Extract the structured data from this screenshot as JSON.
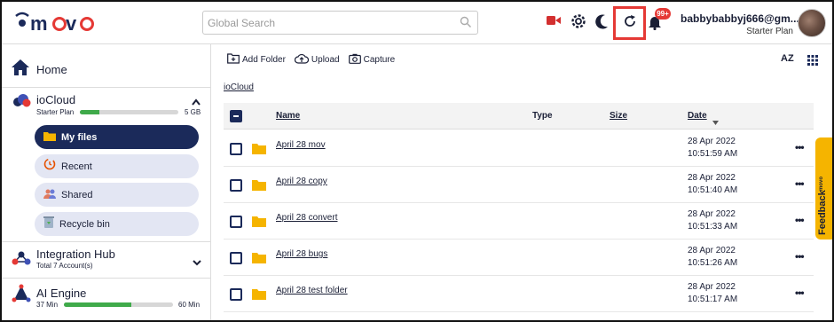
{
  "header": {
    "logo_text": "movo",
    "search_placeholder": "Global Search",
    "notification_count": "99+",
    "user_email": "babbybabbyj666@gm...",
    "user_plan": "Starter Plan"
  },
  "sidebar": {
    "home_label": "Home",
    "iocloud": {
      "title": "ioCloud",
      "plan": "Starter Plan",
      "quota": "5 GB",
      "usage_fraction": 0.2
    },
    "nav": [
      {
        "label": "My files",
        "active": true
      },
      {
        "label": "Recent",
        "active": false
      },
      {
        "label": "Shared",
        "active": false
      },
      {
        "label": "Recycle bin",
        "active": false
      }
    ],
    "integration_hub": {
      "title": "Integration Hub",
      "subtitle": "Total 7 Account(s)"
    },
    "ai_engine": {
      "title": "AI Engine",
      "used": "37 Min",
      "total": "60 Min",
      "usage_fraction": 0.617
    }
  },
  "toolbar": {
    "add_folder": "Add Folder",
    "upload": "Upload",
    "capture": "Capture",
    "sort_label": "AZ"
  },
  "breadcrumb": "ioCloud",
  "table": {
    "columns": {
      "name": "Name",
      "type": "Type",
      "size": "Size",
      "date": "Date"
    },
    "rows": [
      {
        "name": "April 28 mov",
        "date": "28 Apr 2022",
        "time": "10:51:59 AM"
      },
      {
        "name": "April 28 copy",
        "date": "28 Apr 2022",
        "time": "10:51:40 AM"
      },
      {
        "name": "April 28 convert",
        "date": "28 Apr 2022",
        "time": "10:51:33 AM"
      },
      {
        "name": "April 28 bugs",
        "date": "28 Apr 2022",
        "time": "10:51:26 AM"
      },
      {
        "name": "April 28 test folder",
        "date": "28 Apr 2022",
        "time": "10:51:17 AM"
      }
    ]
  },
  "feedback": {
    "label": "Feedback",
    "brand": "movo"
  },
  "colors": {
    "accent": "#1b2a5a",
    "highlight": "#e53935",
    "progress": "#3faa4a",
    "feedback": "#f5b400",
    "folder": "#f5b400"
  }
}
